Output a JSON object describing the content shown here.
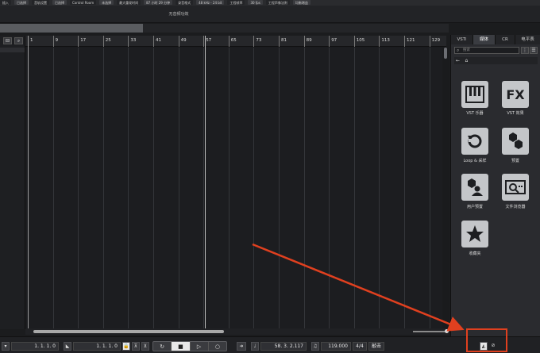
{
  "topbar": {
    "cells": [
      "插入",
      "已选择",
      "音轨设置",
      "已选择",
      "Control Room",
      "未选择",
      "最大重现时间",
      "87 小时 29 分钟",
      "录音格式",
      "48 kHz - 24 bit",
      "工程帧率",
      "30 fps",
      "工程声像法则",
      "均衡增益"
    ]
  },
  "infobar": {
    "title": "无音频功效"
  },
  "ruler": {
    "bars": [
      "1",
      "9",
      "17",
      "25",
      "33",
      "41",
      "49",
      "57",
      "65",
      "73",
      "81",
      "89",
      "97",
      "105",
      "113",
      "121",
      "129"
    ]
  },
  "right_panel": {
    "tabs": [
      "VSTi",
      "媒体",
      "CR",
      "电平表"
    ],
    "active_tab": "媒体",
    "search_placeholder": "搜索",
    "tiles": [
      {
        "label": "VST 乐器",
        "icon": "piano-icon"
      },
      {
        "label": "VST 效果",
        "icon": "fx-icon"
      },
      {
        "label": "Loop & 采样",
        "icon": "loop-icon"
      },
      {
        "label": "预置",
        "icon": "hexagons-icon"
      },
      {
        "label": "用户预置",
        "icon": "user-preset-icon"
      },
      {
        "label": "文件浏览器",
        "icon": "file-browser-icon"
      },
      {
        "label": "收藏夹",
        "icon": "star-icon"
      }
    ]
  },
  "transport": {
    "left_locator": "1. 1. 1.  0",
    "right_locator": "1. 1. 1.  0",
    "position": "58. 3. 2.117",
    "tempo": "119.000",
    "signature": "4/4",
    "click": "敲击"
  },
  "colors": {
    "accent": "#e0401f",
    "background": "#1b1c1e",
    "tile": "#c4c6c9"
  }
}
